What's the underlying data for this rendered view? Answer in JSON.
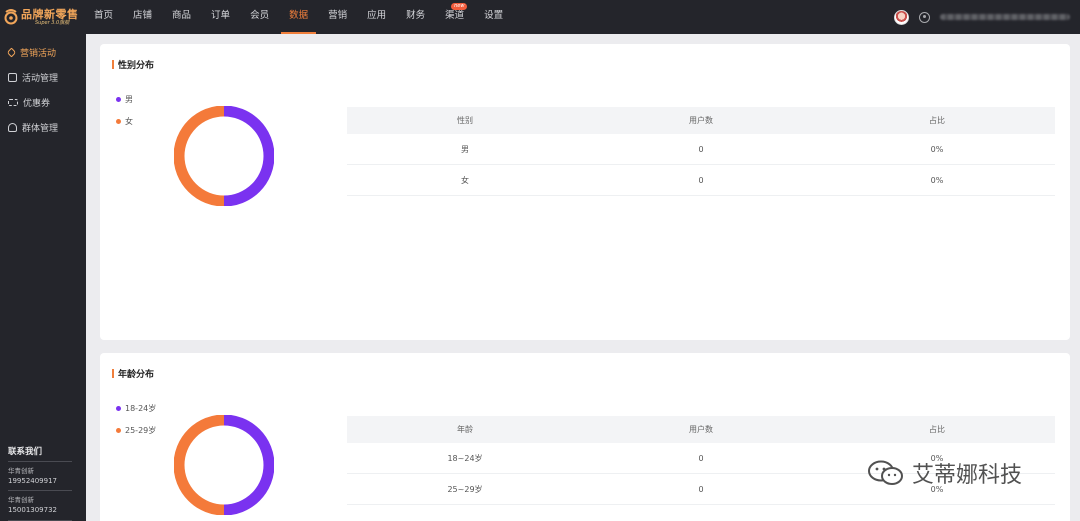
{
  "brand": {
    "title": "品牌新零售",
    "subtitle": "Super 3.0旗舰"
  },
  "nav": {
    "items": [
      {
        "label": "首页"
      },
      {
        "label": "店铺"
      },
      {
        "label": "商品"
      },
      {
        "label": "订单"
      },
      {
        "label": "会员"
      },
      {
        "label": "数据",
        "active": true
      },
      {
        "label": "营销"
      },
      {
        "label": "应用"
      },
      {
        "label": "财务"
      },
      {
        "label": "渠道",
        "badge": "new"
      },
      {
        "label": "设置"
      }
    ]
  },
  "sidebar": {
    "items": [
      {
        "label": "营销活动",
        "icon": "tag-icon",
        "active": true
      },
      {
        "label": "活动管理",
        "icon": "calendar-icon"
      },
      {
        "label": "优惠券",
        "icon": "coupon-icon"
      },
      {
        "label": "群体管理",
        "icon": "people-icon"
      }
    ],
    "contact": {
      "title": "联系我们",
      "entries": [
        {
          "name": "华青创新",
          "phone": "19952409917"
        },
        {
          "name": "华青创新",
          "phone": "15001309732"
        }
      ]
    }
  },
  "gender": {
    "title": "性别分布",
    "legend": [
      {
        "label": "男",
        "color": "#7a32f0"
      },
      {
        "label": "女",
        "color": "#f47a3a"
      }
    ],
    "columns": [
      "性别",
      "用户数",
      "占比"
    ],
    "rows": [
      [
        "男",
        "0",
        "0%"
      ],
      [
        "女",
        "0",
        "0%"
      ]
    ]
  },
  "age": {
    "title": "年龄分布",
    "legend": [
      {
        "label": "18-24岁",
        "color": "#7a32f0"
      },
      {
        "label": "25-29岁",
        "color": "#f47a3a"
      }
    ],
    "columns": [
      "年龄",
      "用户数",
      "占比"
    ],
    "rows": [
      [
        "18~24岁",
        "0",
        "0%"
      ],
      [
        "25~29岁",
        "0",
        "0%"
      ]
    ]
  },
  "watermark": {
    "text": "艾蒂娜科技"
  },
  "colors": {
    "accent": "#f07f3c",
    "purple": "#7a32f0",
    "orange": "#f47a3a",
    "dark": "#24252b"
  }
}
